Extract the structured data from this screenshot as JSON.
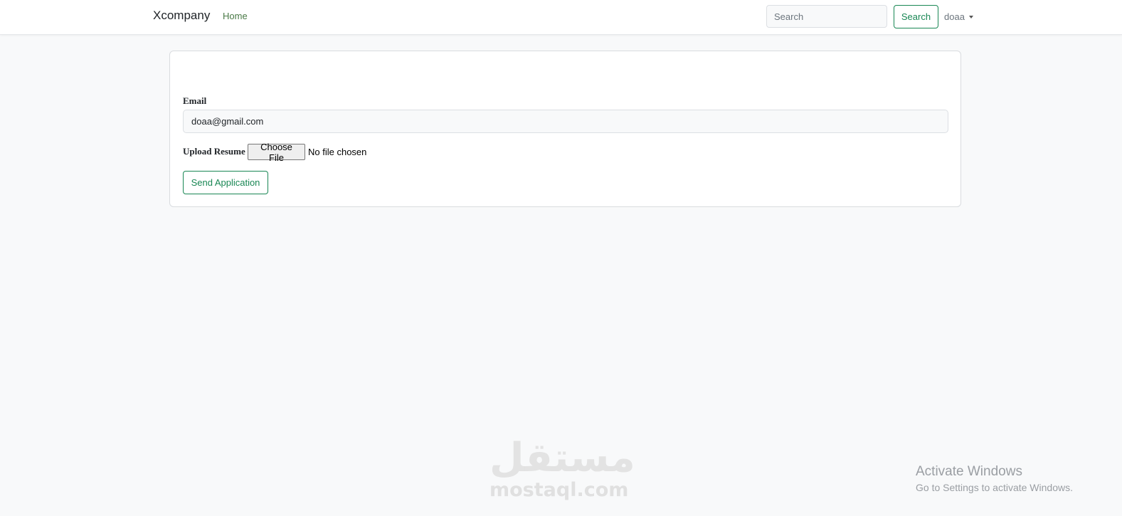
{
  "navbar": {
    "brand": "Xcompany",
    "home_link": "Home",
    "search_placeholder": "Search",
    "search_button": "Search",
    "user_name": "doaa"
  },
  "form": {
    "email_label": "Email",
    "email_value": "doaa@gmail.com",
    "upload_label": "Upload Resume",
    "choose_file_label": "Choose File",
    "file_status": "No file chosen",
    "submit_button": "Send Application"
  },
  "watermark": {
    "arabic": "مستقل",
    "domain": "mostaql.com"
  },
  "windows_notice": {
    "title": "Activate Windows",
    "subtitle": "Go to Settings to activate Windows."
  },
  "colors": {
    "accent": "#198754",
    "home_link": "#4a7a47",
    "background": "#f8f9fa"
  }
}
